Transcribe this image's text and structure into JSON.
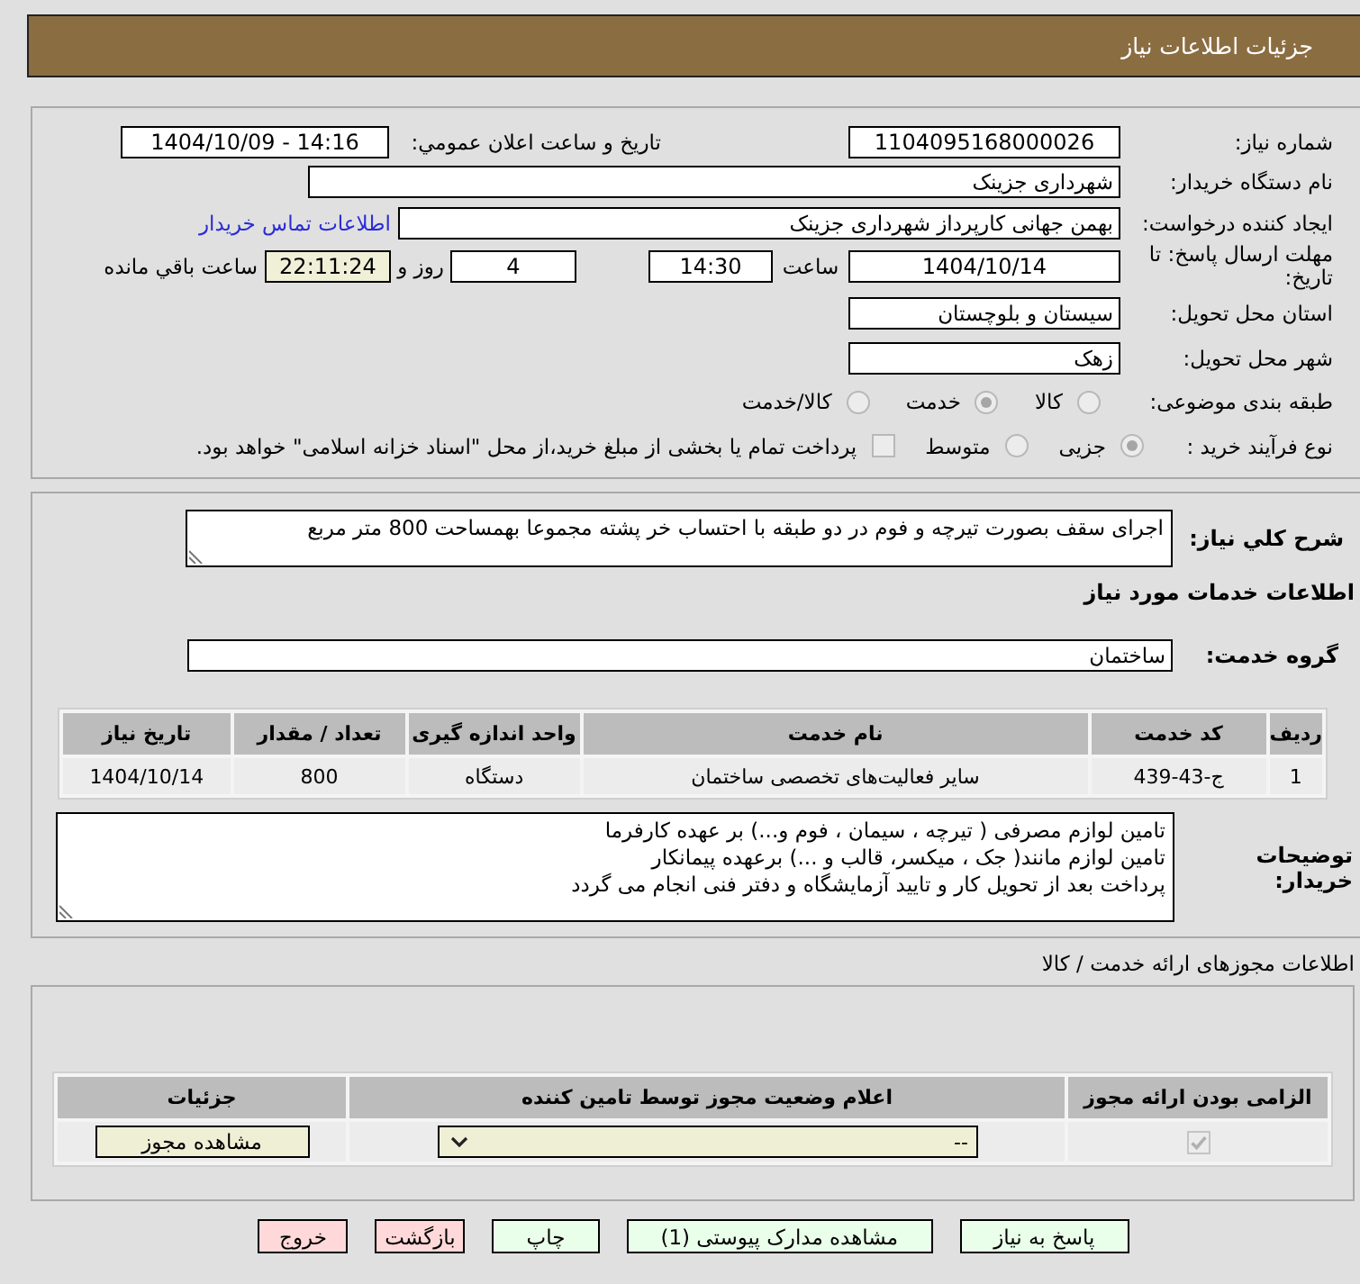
{
  "header": {
    "title": "جزئیات اطلاعات نیاز"
  },
  "details": {
    "need_number": {
      "label": "شماره نیاز:",
      "value": "1104095168000026"
    },
    "announced": {
      "label": "تاریخ و ساعت اعلان عمومي:",
      "value": "1404/10/09 - 14:16"
    },
    "buyer": {
      "label": "نام دستگاه خریدار:",
      "value": "شهرداری جزینک"
    },
    "requester": {
      "label": "ایجاد کننده درخواست:",
      "value": "بهمن جهانی کارپرداز شهرداری جزینک",
      "link": "اطلاعات تماس خریدار"
    },
    "deadline": {
      "label": "مهلت ارسال پاسخ: تا تاریخ:",
      "date": "1404/10/14",
      "time_label": "ساعت",
      "time": "14:30",
      "days": "4",
      "days_label": "روز و",
      "remaining": "22:11:24",
      "remaining_label": "ساعت باقي مانده"
    },
    "province": {
      "label": "استان محل تحویل:",
      "value": "سیستان و بلوچستان"
    },
    "city": {
      "label": "شهر محل تحویل:",
      "value": "زهک"
    },
    "category": {
      "label": "طبقه بندی موضوعی:",
      "options": [
        {
          "label": "کالا",
          "selected": false
        },
        {
          "label": "خدمت",
          "selected": true
        },
        {
          "label": "کالا/خدمت",
          "selected": false
        }
      ]
    },
    "process": {
      "label": "نوع فرآیند خرید :",
      "options": [
        {
          "label": "جزیی",
          "selected": true
        },
        {
          "label": "متوسط",
          "selected": false
        }
      ],
      "treasury": {
        "label": "پرداخت تمام یا بخشی از مبلغ خرید،از محل \"اسناد خزانه اسلامی\" خواهد بود.",
        "checked": false
      }
    }
  },
  "summary": {
    "label": "شرح کلي نیاز:",
    "value": "اجرای سقف بصورت تیرچه و فوم در دو طبقه با احتساب خر پشته مجموعا بهمساحت 800 متر مربع"
  },
  "services": {
    "heading": "اطلاعات خدمات مورد نیاز",
    "group_label": "گروه خدمت:",
    "group": "ساختمان",
    "table": {
      "columns": [
        "ردیف",
        "کد خدمت",
        "نام خدمت",
        "واحد اندازه گیری",
        "تعداد / مقدار",
        "تاریخ نیاز"
      ],
      "rows": [
        [
          "1",
          "ج-43-439",
          "سایر فعالیت‌های تخصصی ساختمان",
          "دستگاه",
          "800",
          "1404/10/14"
        ]
      ]
    }
  },
  "buyer_notes": {
    "label": "توضیحات خریدار:",
    "lines": [
      "تامین لوازم مصرفی ( تیرچه ، سیمان ، فوم و...) بر عهده کارفرما",
      "تامین لوازم مانند( جک ، میکسر، قالب و ...) برعهده پیمانکار",
      "پرداخت بعد از تحویل کار و تایید آزمایشگاه و دفتر فنی انجام می گردد"
    ]
  },
  "permits": {
    "heading": "اطلاعات مجوزهای ارائه خدمت / کالا",
    "table": {
      "columns": [
        "الزامی بودن ارائه مجوز",
        "اعلام وضعیت مجوز توسط تامین کننده",
        "جزئیات"
      ],
      "rows": [
        {
          "required": true,
          "status": "--",
          "action": "مشاهده مجوز"
        }
      ]
    }
  },
  "buttons": [
    {
      "label": "پاسخ به نیاز",
      "kind": "proceed"
    },
    {
      "label": "مشاهده مدارک پیوستی (1)",
      "kind": "proceed"
    },
    {
      "label": "چاپ",
      "kind": "proceed"
    },
    {
      "label": "بازگشت",
      "kind": "leave"
    },
    {
      "label": "خروج",
      "kind": "leave"
    }
  ]
}
